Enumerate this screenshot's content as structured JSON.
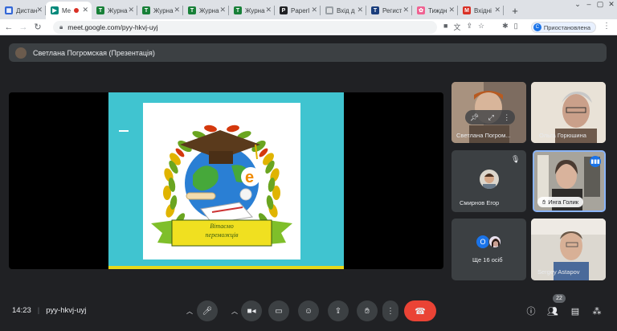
{
  "browser": {
    "tabs": [
      {
        "label": "Дистан",
        "favicon_color": "#3367d6",
        "favicon_glyph": "▦"
      },
      {
        "label": "Me",
        "favicon_color": "#00897b",
        "favicon_glyph": "▶",
        "active": true
      },
      {
        "label": "Журна",
        "favicon_color": "#188038",
        "favicon_glyph": "T"
      },
      {
        "label": "Журна",
        "favicon_color": "#188038",
        "favicon_glyph": "T"
      },
      {
        "label": "Журна",
        "favicon_color": "#188038",
        "favicon_glyph": "T"
      },
      {
        "label": "Журна",
        "favicon_color": "#188038",
        "favicon_glyph": "T"
      },
      {
        "label": "Paperl",
        "favicon_color": "#202124",
        "favicon_glyph": "P"
      },
      {
        "label": "Вхід д",
        "favicon_color": "#9aa0a6",
        "favicon_glyph": "▤"
      },
      {
        "label": "Регист",
        "favicon_color": "#1a3d7c",
        "favicon_glyph": "T"
      },
      {
        "label": "Тиждн",
        "favicon_color": "#f06292",
        "favicon_glyph": "✿"
      },
      {
        "label": "Вхідні",
        "favicon_color": "#d93025",
        "favicon_glyph": "M"
      }
    ],
    "url": "meet.google.com/pyy-hkvj-uyj",
    "profile_label": "Приостановлена",
    "profile_initial": "C"
  },
  "meet": {
    "presenter_bar": "Светлана Погромская (Презентація)",
    "slide": {
      "line1": "Вітаємо",
      "line2": "переможців"
    },
    "tiles": [
      {
        "name": "Светлана Погром...",
        "pinned": true
      },
      {
        "name": "Ольга Горюшина"
      },
      {
        "name": "Смирнов Егор",
        "muted": true
      },
      {
        "name": "Инга Голик",
        "speaking": true
      },
      {
        "name": "Ще 16 осіб",
        "initial": "О"
      },
      {
        "name": "Sergey Astapov"
      }
    ],
    "time": "14:23",
    "meeting_code": "pyy-hkvj-uyj",
    "participants_count": "22"
  },
  "colors": {
    "end_call": "#ea4335",
    "accent": "#8ab4f8"
  }
}
